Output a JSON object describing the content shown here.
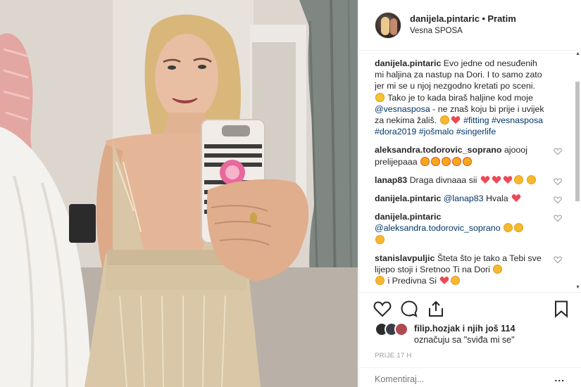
{
  "post": {
    "photo_alt": "",
    "author": "danijela.pintaric",
    "separator": "•",
    "follow_label": "Pratim",
    "location": "Vesna SPOSA"
  },
  "caption": {
    "user": "danijela.pintaric",
    "text1": "Evo jedne od nesuđenih mi haljina za nastup na Dori. I to samo zato jer mi se u njoj nezgodno kretati po sceni.",
    "text2": "Tako je to kada biraš haljine kod moje",
    "mention": "@vesnasposa",
    "text3": "- ne znaš koju bi prije i uvijek za nekima žališ.",
    "hashtag1": "#fitting",
    "hashtag2": "#vesnasposa",
    "hashtag3": "#dora2019",
    "hashtag4": "#jošmalo",
    "hashtag5": "#singerlife"
  },
  "comments": [
    {
      "user": "aleksandra.todorovic_soprano",
      "text": "ajoooj prelijepaaa"
    },
    {
      "user": "lanap83",
      "text": "Draga divnaaa sii"
    },
    {
      "user": "danijela.pintaric",
      "mention": "@lanap83",
      "text": "Hvala"
    },
    {
      "user": "danijela.pintaric",
      "mention": "@aleksandra.todorovic_soprano",
      "text": ""
    },
    {
      "user": "stanislavpuljic",
      "text": "Šteta što je tako a Tebi sve lijepo stoji i Sretnoo Ti na Dori",
      "text2": "i Predivna Si"
    }
  ],
  "likes": {
    "line1_user": "filip.hozjak",
    "line1_rest": "i njih još 114",
    "line2": "označuju sa \"sviđa mi se\""
  },
  "time": "PRIJE 17 H",
  "add_comment": {
    "placeholder": "Komentiraj...",
    "more": "..."
  },
  "colors": {
    "link": "#003569",
    "heart_red": "#ed4956",
    "text": "#262626",
    "muted": "#999999"
  },
  "icons": [
    "heart-icon",
    "comment-icon",
    "share-icon",
    "bookmark-icon",
    "more-icon"
  ]
}
